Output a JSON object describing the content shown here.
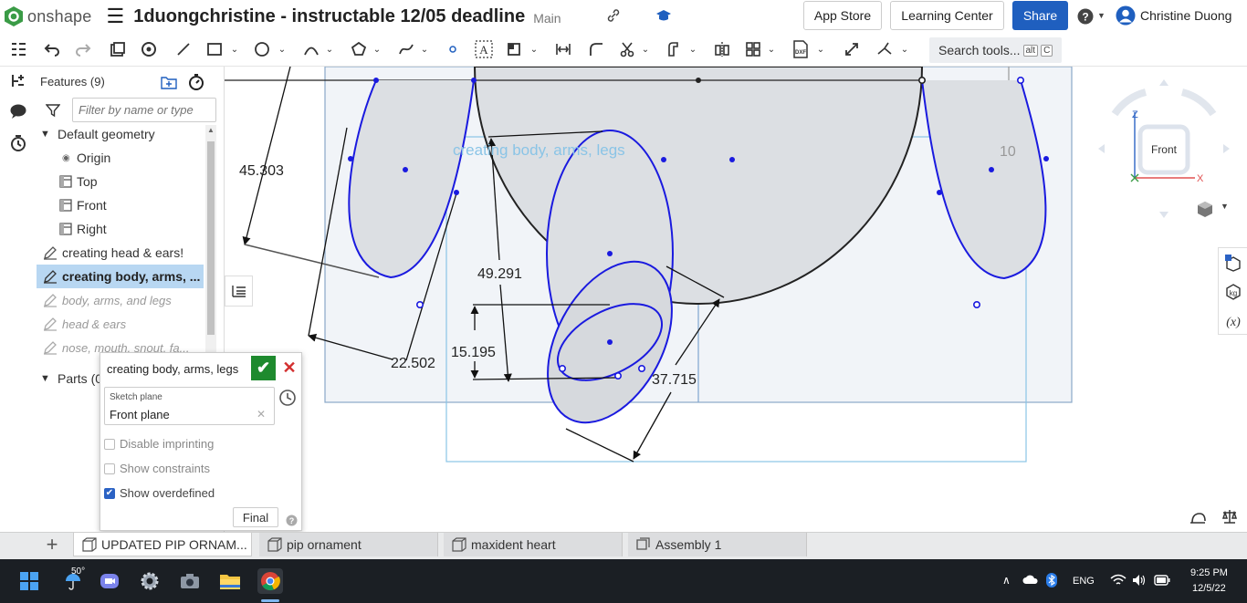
{
  "app": {
    "name": "onshape",
    "title": "1duongchristine - instructable 12/05 deadline",
    "branch": "Main"
  },
  "header": {
    "app_store": "App Store",
    "learning_center": "Learning Center",
    "share": "Share",
    "help": "?",
    "user": "Christine Duong"
  },
  "toolbar": {
    "search_placeholder": "Search tools...",
    "search_key1": "alt",
    "search_key2": "C"
  },
  "features": {
    "title": "Features (9)",
    "filter_placeholder": "Filter by name or type",
    "default_geometry": "Default geometry",
    "origin": "Origin",
    "items": [
      "Top",
      "Front",
      "Right"
    ],
    "sketches": [
      "creating head & ears!",
      "creating body, arms, ...",
      "body, arms, and legs",
      "head & ears",
      "nose, mouth, snout, fa..."
    ],
    "parts": "Parts (0"
  },
  "dialog": {
    "title": "creating body, arms, legs",
    "plane_label": "Sketch plane",
    "plane_value": "Front plane",
    "opt1": "Disable imprinting",
    "opt2": "Show constraints",
    "opt3": "Show overdefined",
    "final": "Final"
  },
  "sketch": {
    "dim1": "45.303",
    "dim2": "49.291",
    "dim3": "15.195",
    "dim4": "22.502",
    "dim5": "37.715",
    "dim6": "10",
    "label": "creating body, arms, legs"
  },
  "viewcube": {
    "face": "Front",
    "z": "Z",
    "x": "X"
  },
  "tabs": [
    "UPDATED PIP ORNAM...",
    "pip ornament",
    "maxident heart",
    "Assembly 1"
  ],
  "taskbar": {
    "temp": "50°",
    "lang": "ENG",
    "time": "9:25 PM",
    "date": "12/5/22"
  },
  "colors": {
    "share": "#1f5fbf",
    "sketch_blue": "#1a1adf",
    "selected": "#b8d7f2",
    "ok_green": "#1e8a2e"
  }
}
